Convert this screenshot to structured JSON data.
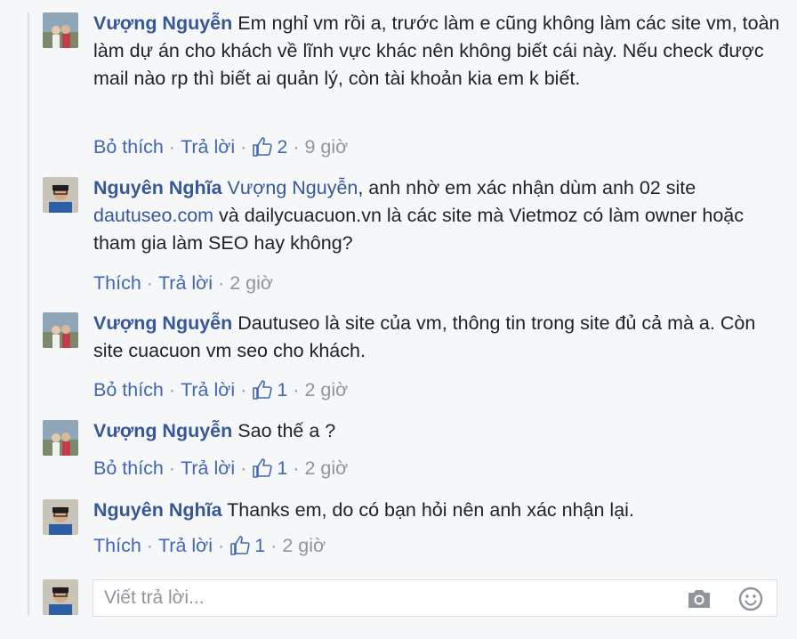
{
  "comments": [
    {
      "author": "Vượng Nguyễn",
      "text": "Em nghỉ vm rồi a, trước làm e cũng không làm các site vm, toàn làm dự án cho khách về lĩnh vực khác nên không biết cái này. Nếu check được mail nào rp thì biết ai quản lý, còn tài khoản kia em k biết.",
      "like_action": "Bỏ thích",
      "reply_action": "Trả lời",
      "likes": "2",
      "time": "9 giờ"
    },
    {
      "author": "Nguyên Nghĩa",
      "mention": "Vượng Nguyễn",
      "text_before_link": ", anh nhờ em xác nhận dùm anh 02 site ",
      "link": "dautuseo.com",
      "text_after_link": " và dailycuacuon.vn là các site mà Vietmoz có làm owner hoặc tham gia làm SEO hay không?",
      "like_action": "Thích",
      "reply_action": "Trả lời",
      "time": "2 giờ"
    },
    {
      "author": "Vượng Nguyễn",
      "text": "Dautuseo là site của vm, thông tin trong site đủ cả mà a. Còn site cuacuon vm seo cho khách.",
      "like_action": "Bỏ thích",
      "reply_action": "Trả lời",
      "likes": "1",
      "time": "2 giờ"
    },
    {
      "author": "Vượng Nguyễn",
      "text": "Sao thế a ?",
      "like_action": "Bỏ thích",
      "reply_action": "Trả lời",
      "likes": "1",
      "time": "2 giờ"
    },
    {
      "author": "Nguyên Nghĩa",
      "text": "Thanks em, do có bạn hỏi nên anh xác nhận lại.",
      "like_action": "Thích",
      "reply_action": "Trả lời",
      "likes": "1",
      "time": "2 giờ"
    }
  ],
  "reply_box": {
    "placeholder": "Viết trả lời..."
  },
  "colors": {
    "link": "#365899",
    "action": "#4267b2",
    "meta": "#90949c",
    "text": "#1d2129"
  },
  "icons": [
    "thumbs-up-icon",
    "camera-icon",
    "smile-icon"
  ]
}
